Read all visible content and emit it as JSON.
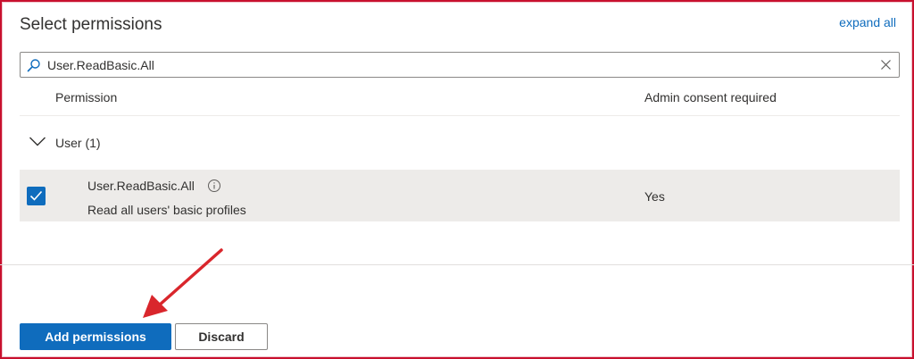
{
  "panel": {
    "title": "Select permissions",
    "expand_all": "expand all"
  },
  "search": {
    "value": "User.ReadBasic.All",
    "icon": "search-icon",
    "clear_icon": "close-icon"
  },
  "table": {
    "columns": [
      "Permission",
      "Admin consent required"
    ],
    "group": {
      "label": "User (1)",
      "expanded": true
    },
    "rows": [
      {
        "name": "User.ReadBasic.All",
        "description": "Read all users' basic profiles",
        "admin_consent": "Yes",
        "checked": true
      }
    ]
  },
  "footer": {
    "add_label": "Add permissions",
    "discard_label": "Discard"
  },
  "colors": {
    "accent": "#0f6cbd",
    "annotation": "#d9262c",
    "frame": "#c8102e",
    "row_selected": "#edebe9"
  }
}
